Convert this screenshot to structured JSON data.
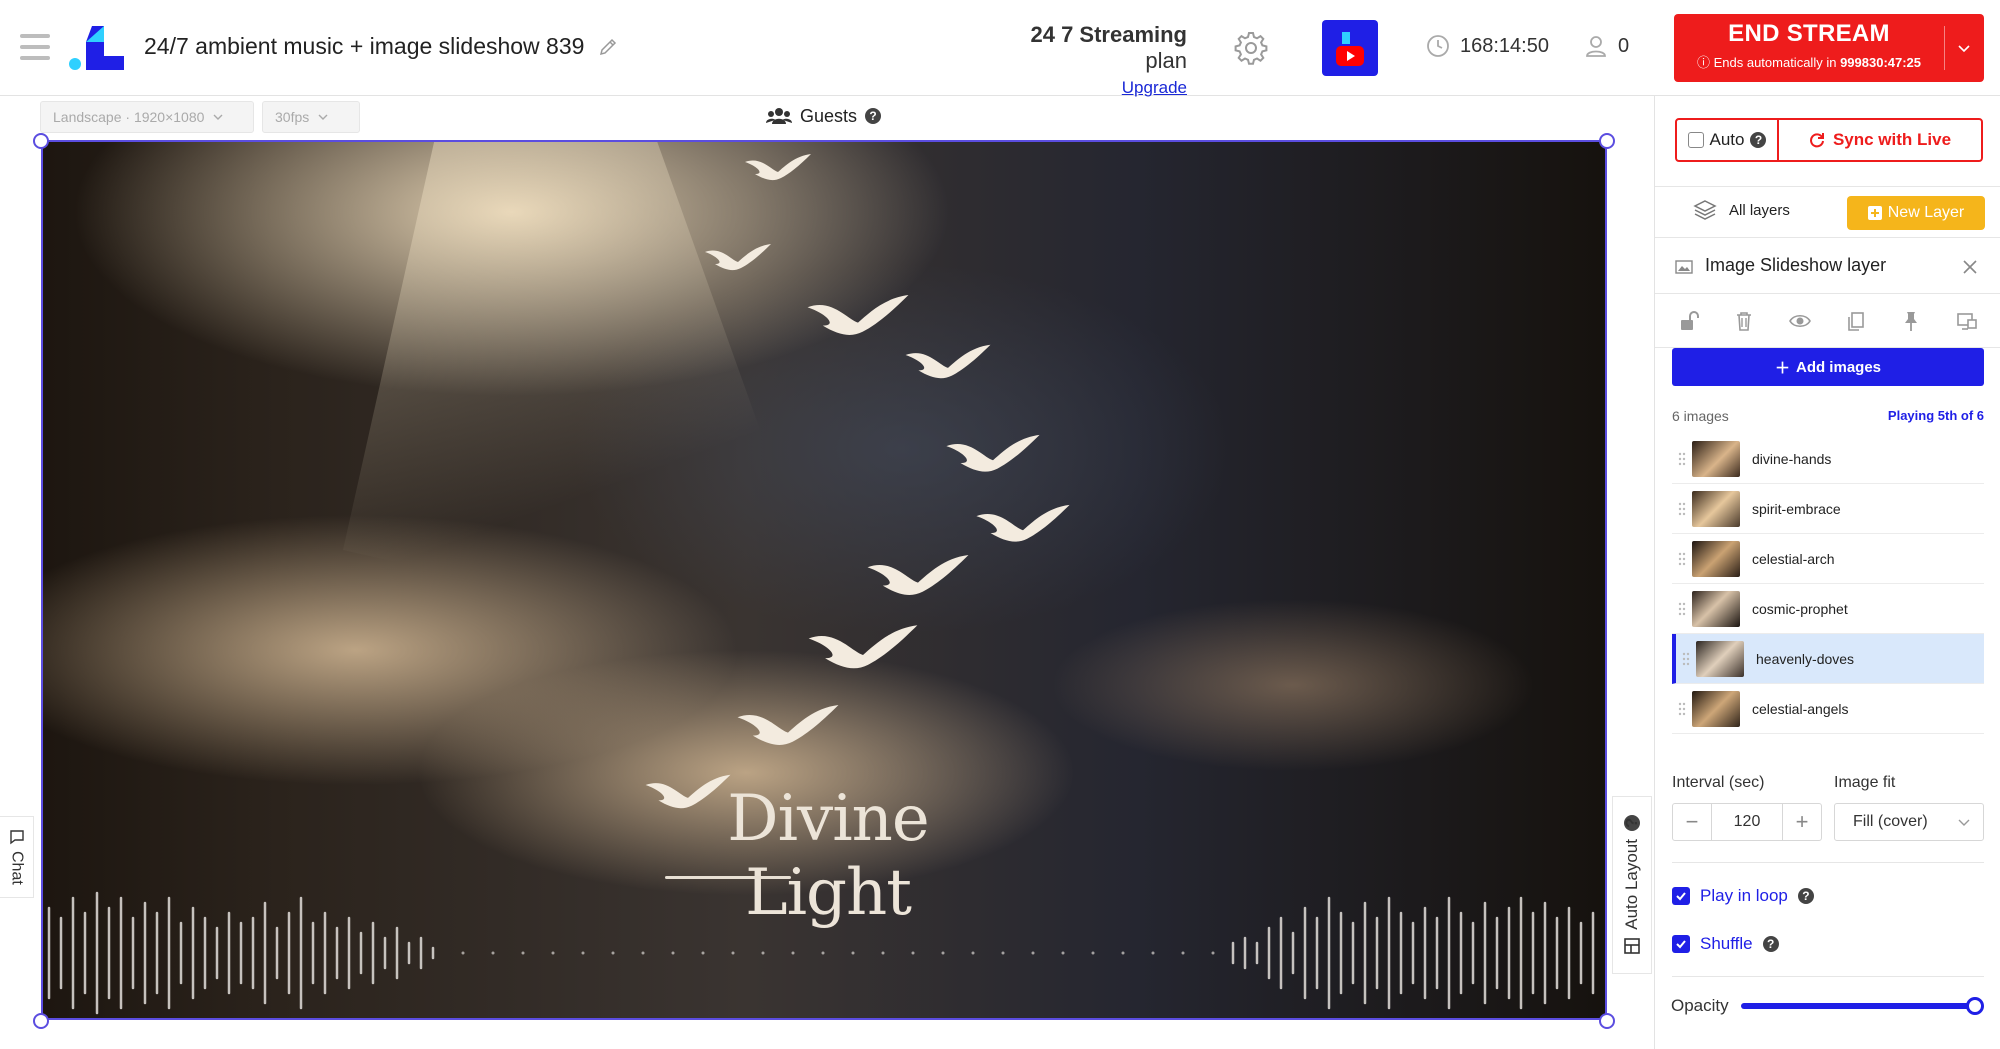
{
  "header": {
    "title": "24/7 ambient music + image slideshow 839",
    "plan_name": "24 7 Streaming",
    "plan_suffix": "plan",
    "upgrade": "Upgrade",
    "elapsed": "168:14:50",
    "viewers": "0",
    "end_stream": "END STREAM",
    "ends_prefix": "Ends automatically in",
    "ends_in": "999830:47:25"
  },
  "canvas": {
    "orientation": "Landscape · 1920×1080",
    "fps": "30fps",
    "guests": "Guests",
    "overlay_title": "Divine Light"
  },
  "side_tabs": {
    "chat": "Chat",
    "auto_layout": "Auto Layout"
  },
  "panel": {
    "auto": "Auto",
    "sync": "Sync with Live",
    "all_layers": "All layers",
    "new_layer": "New Layer",
    "layer_title": "Image Slideshow layer",
    "add_images": "Add images",
    "image_count": "6 images",
    "playing": "Playing 5th of 6",
    "images": [
      {
        "name": "divine-hands",
        "active": false
      },
      {
        "name": "spirit-embrace",
        "active": false
      },
      {
        "name": "celestial-arch",
        "active": false
      },
      {
        "name": "cosmic-prophet",
        "active": false
      },
      {
        "name": "heavenly-doves",
        "active": true
      },
      {
        "name": "celestial-angels",
        "active": false
      }
    ],
    "interval_label": "Interval (sec)",
    "interval_value": "120",
    "image_fit_label": "Image fit",
    "image_fit_value": "Fill (cover)",
    "play_in_loop": "Play in loop",
    "shuffle": "Shuffle",
    "opacity_label": "Opacity",
    "opacity_value": 1.0
  },
  "colors": {
    "accent": "#1f1fe6",
    "danger": "#ee1c1c",
    "new_layer": "#f5b51b",
    "active_row": "#d9e8fb"
  }
}
